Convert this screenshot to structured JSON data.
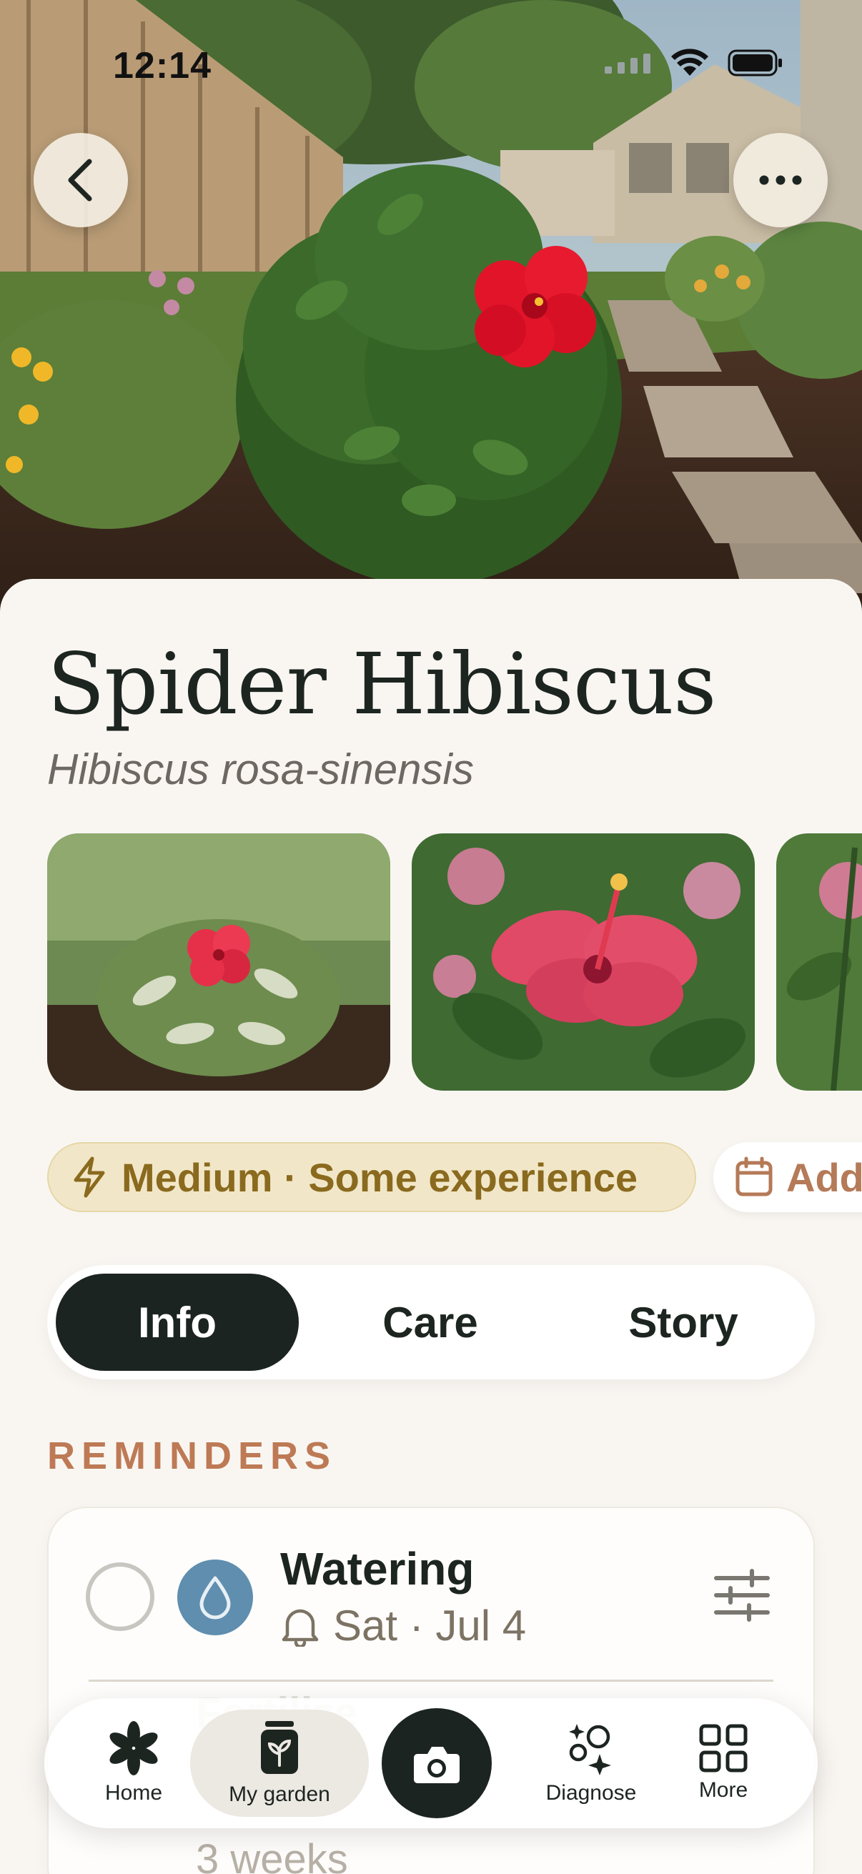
{
  "status_bar": {
    "time": "12:14",
    "icons": [
      "cellular-icon",
      "wifi-icon",
      "battery-icon"
    ]
  },
  "hero": {
    "back_icon": "chevron-left-icon",
    "more_icon": "ellipsis-icon"
  },
  "plant": {
    "common_name": "Spider Hibiscus",
    "scientific_name": "Hibiscus rosa-sinensis"
  },
  "chips": {
    "difficulty": {
      "icon": "lightning-icon",
      "label": "Medium · Some experience"
    },
    "add": {
      "icon": "calendar-icon",
      "label": "Add"
    }
  },
  "tabs": [
    {
      "label": "Info",
      "selected": true
    },
    {
      "label": "Care",
      "selected": false
    },
    {
      "label": "Story",
      "selected": false
    }
  ],
  "reminders": {
    "section_label": "REMINDERS",
    "items": [
      {
        "title": "Watering",
        "icon": "water-drop-icon",
        "bell_icon": "bell-icon",
        "when": "Sat · Jul 4"
      },
      {
        "title": "Fertilize",
        "when": "3 weeks"
      }
    ]
  },
  "nav": {
    "items": [
      {
        "label": "Home",
        "icon": "flower-icon"
      },
      {
        "label": "My garden",
        "icon": "plant-pot-icon",
        "selected": true
      },
      {
        "label": "",
        "icon": "camera-icon"
      },
      {
        "label": "Diagnose",
        "icon": "sparkle-icon"
      },
      {
        "label": "More",
        "icon": "grid-icon"
      }
    ]
  },
  "colors": {
    "accent_dark": "#1c2421",
    "reminder_label": "#bd7a55",
    "difficulty_chip_bg": "#f1e7c8",
    "difficulty_text": "#8a6a1e",
    "water_blue": "#5f8eaf"
  }
}
